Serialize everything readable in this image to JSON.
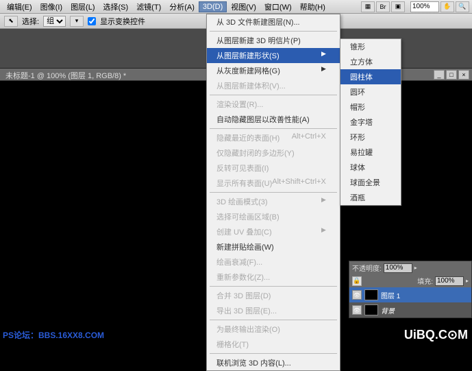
{
  "menubar": {
    "items": [
      "编辑(E)",
      "图像(I)",
      "图层(L)",
      "选择(S)",
      "滤镜(T)",
      "分析(A)",
      "3D(D)",
      "视图(V)",
      "窗口(W)",
      "帮助(H)"
    ],
    "zoom": "100%"
  },
  "options": {
    "label": "选择:",
    "mode": "组",
    "checkbox_label": "显示变换控件"
  },
  "doc_title": "未标题-1 @ 100% (图层 1, RGB/8) *",
  "menu3d": {
    "items": [
      {
        "label": "从 3D 文件新建图层(N)...",
        "disabled": false
      },
      {
        "sep": true
      },
      {
        "label": "从图层新建 3D 明信片(P)",
        "disabled": false
      },
      {
        "label": "从图层新建形状(S)",
        "disabled": false,
        "submenu": true,
        "hl": true
      },
      {
        "label": "从灰度新建网格(G)",
        "disabled": false,
        "submenu": true
      },
      {
        "label": "从图层新建体积(V)...",
        "disabled": true
      },
      {
        "sep": true
      },
      {
        "label": "渲染设置(R)...",
        "disabled": true
      },
      {
        "label": "自动隐藏图层以改善性能(A)",
        "disabled": false
      },
      {
        "sep": true
      },
      {
        "label": "隐藏最近的表面(H)",
        "shortcut": "Alt+Ctrl+X",
        "disabled": true
      },
      {
        "label": "仅隐藏封闭的多边形(Y)",
        "disabled": true
      },
      {
        "label": "反转可见表面(I)",
        "disabled": true
      },
      {
        "label": "显示所有表面(U)",
        "shortcut": "Alt+Shift+Ctrl+X",
        "disabled": true
      },
      {
        "sep": true
      },
      {
        "label": "3D 绘画模式(3)",
        "disabled": true,
        "submenu": true
      },
      {
        "label": "选择可绘画区域(B)",
        "disabled": true
      },
      {
        "label": "创建 UV 叠加(C)",
        "disabled": true,
        "submenu": true
      },
      {
        "label": "新建拼贴绘画(W)",
        "disabled": false
      },
      {
        "label": "绘画衰减(F)...",
        "disabled": true
      },
      {
        "label": "重新参数化(Z)...",
        "disabled": true
      },
      {
        "sep": true
      },
      {
        "label": "合并 3D 图层(D)",
        "disabled": true
      },
      {
        "label": "导出 3D 图层(E)...",
        "disabled": true
      },
      {
        "sep": true
      },
      {
        "label": "为最终输出渲染(O)",
        "disabled": true
      },
      {
        "label": "栅格化(T)",
        "disabled": true
      },
      {
        "sep": true
      },
      {
        "label": "联机浏览 3D 内容(L)...",
        "disabled": false
      }
    ]
  },
  "submenu_shapes": [
    {
      "label": "锥形"
    },
    {
      "label": "立方体"
    },
    {
      "label": "圆柱体",
      "hl": true
    },
    {
      "label": "圆环"
    },
    {
      "label": "帽形"
    },
    {
      "label": "金字塔"
    },
    {
      "label": "环形"
    },
    {
      "label": "易拉罐"
    },
    {
      "label": "球体"
    },
    {
      "label": "球面全景"
    },
    {
      "label": "酒瓶"
    }
  ],
  "panels": {
    "opacity_label": "不透明度:",
    "opacity": "100%",
    "fill_label": "填充:",
    "fill": "100%",
    "layers": [
      {
        "name": "图层 1",
        "active": true
      },
      {
        "name": "背景",
        "active": false
      }
    ]
  },
  "watermark": "PS论坛：BBS.16XX8.COM",
  "logo": "UiBQ.C⊙M",
  "logourl": "www.rs2000.cn"
}
